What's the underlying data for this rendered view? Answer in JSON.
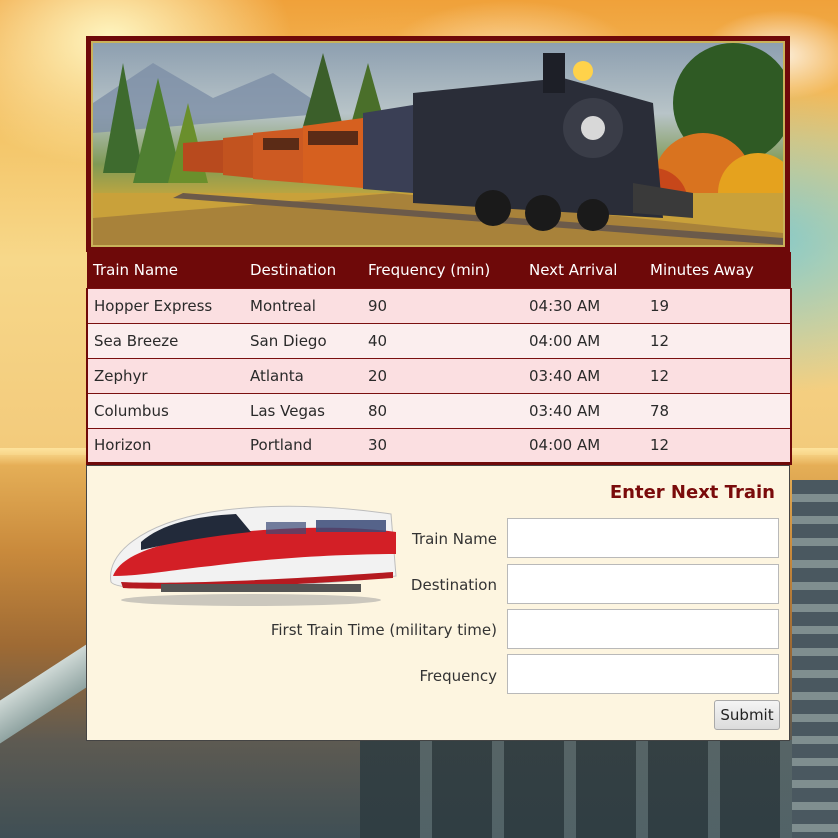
{
  "schedule": {
    "headers": [
      "Train Name",
      "Destination",
      "Frequency (min)",
      "Next Arrival",
      "Minutes Away"
    ],
    "rows": [
      [
        "Hopper Express",
        "Montreal",
        "90",
        "04:30 AM",
        "19"
      ],
      [
        "Sea Breeze",
        "San Diego",
        "40",
        "04:00 AM",
        "12"
      ],
      [
        "Zephyr",
        "Atlanta",
        "20",
        "03:40 AM",
        "12"
      ],
      [
        "Columbus",
        "Las Vegas",
        "80",
        "03:40 AM",
        "78"
      ],
      [
        "Horizon",
        "Portland",
        "30",
        "04:00 AM",
        "12"
      ]
    ]
  },
  "form": {
    "title": "Enter Next Train",
    "train_name_label": "Train Name",
    "destination_label": "Destination",
    "first_time_label": "First Train Time (military time)",
    "frequency_label": "Frequency",
    "submit_label": "Submit"
  },
  "colors": {
    "accent": "#6e0909",
    "row_odd": "#fbdfe1",
    "row_even": "#fbeeee",
    "form_bg": "#fdf5e0",
    "title": "#7a0b0b"
  },
  "images": {
    "hero": "steam-train-photo",
    "form": "bullet-train-photo"
  }
}
